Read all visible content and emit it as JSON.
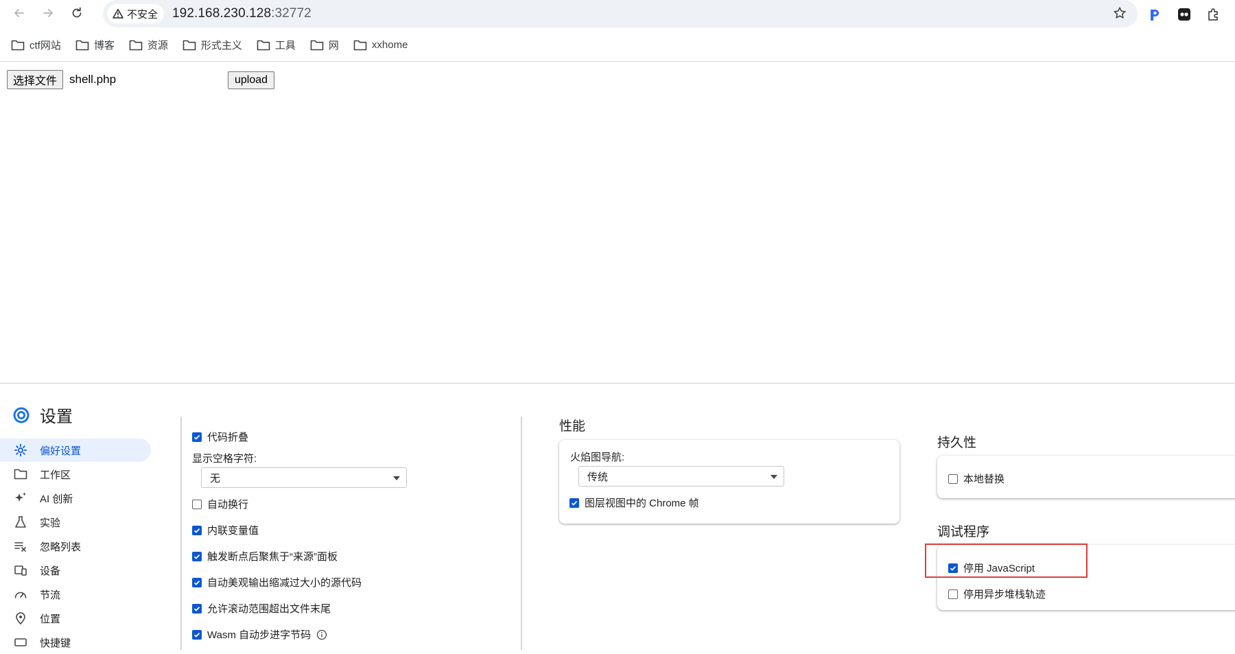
{
  "browser": {
    "security_label": "不安全",
    "url_host": "192.168.230.128",
    "url_port": ":32772"
  },
  "bookmarks": [
    {
      "label": "ctf网站"
    },
    {
      "label": "博客"
    },
    {
      "label": "资源"
    },
    {
      "label": "形式主义"
    },
    {
      "label": "工具"
    },
    {
      "label": "网"
    },
    {
      "label": "xxhome"
    }
  ],
  "page": {
    "choose_file_label": "选择文件",
    "chosen_file": "shell.php",
    "upload_label": "upload"
  },
  "devtools": {
    "title": "设置",
    "sidebar": [
      {
        "label": "偏好设置",
        "icon": "gear-icon",
        "active": true
      },
      {
        "label": "工作区",
        "icon": "folder-icon"
      },
      {
        "label": "AI 创新",
        "icon": "sparkle-icon"
      },
      {
        "label": "实验",
        "icon": "flask-icon"
      },
      {
        "label": "忽略列表",
        "icon": "ignore-list-icon"
      },
      {
        "label": "设备",
        "icon": "devices-icon"
      },
      {
        "label": "节流",
        "icon": "throttle-icon"
      },
      {
        "label": "位置",
        "icon": "location-pin-icon"
      },
      {
        "label": "快捷键",
        "icon": "keyboard-icon"
      }
    ],
    "sources_options": {
      "code_folding": "代码折叠",
      "show_whitespace_label": "显示空格字符:",
      "show_whitespace_value": "无",
      "word_wrap": "自动换行",
      "inline_values": "内联变量值",
      "focus_sources_on_breakpoint": "触发断点后聚焦于“来源”面板",
      "auto_pretty_print": "自动美观输出缩减过大小的源代码",
      "scroll_past_end": "允许滚动范围超出文件末尾",
      "wasm_auto_step": "Wasm 自动步进字节码"
    },
    "performance": {
      "heading": "性能",
      "flamechart_label": "火焰图导航:",
      "flamechart_value": "传统",
      "chrome_frames": "图层视图中的 Chrome 帧"
    },
    "persistence": {
      "heading": "持久性",
      "local_overrides": "本地替换"
    },
    "debugger": {
      "heading": "调试程序",
      "disable_js": "停用 JavaScript",
      "disable_async_stack": "停用异步堆栈轨迹"
    },
    "colors": {
      "accent": "#0b57d0",
      "highlight_box": "#e23b3b"
    }
  }
}
